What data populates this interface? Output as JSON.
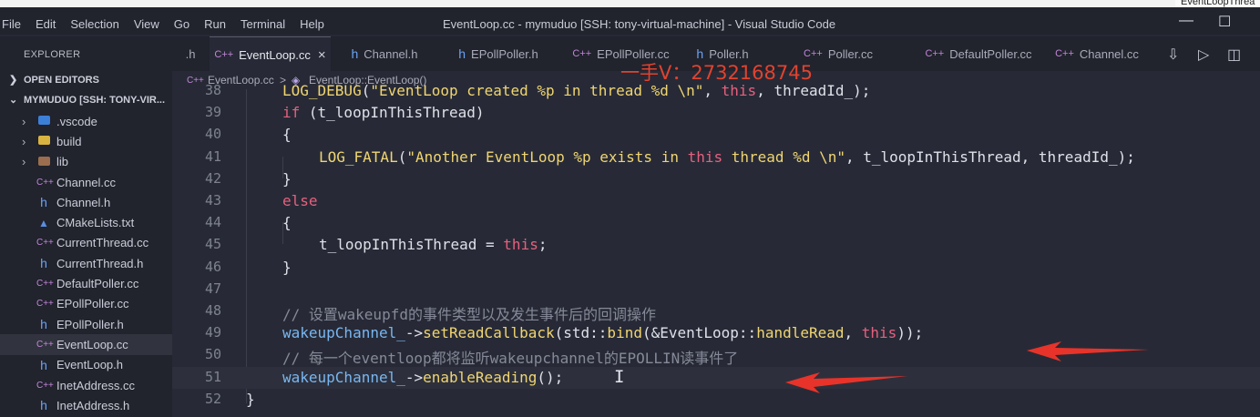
{
  "window": {
    "title": "EventLoop.cc - mymuduo [SSH: tony-virtual-machine] - Visual Studio Code",
    "menu": [
      "File",
      "Edit",
      "Selection",
      "View",
      "Go",
      "Run",
      "Terminal",
      "Help"
    ],
    "minimize": "—",
    "maximize": "☐",
    "top_right_label": "EventLoopThrea"
  },
  "sidebar": {
    "title": "EXPLORER",
    "open_editors": "OPEN EDITORS",
    "workspace": "MYMUDUO [SSH: TONY-VIR...",
    "items": [
      {
        "label": ".vscode",
        "type": "folder",
        "icon": "vscode-folder-icon"
      },
      {
        "label": "build",
        "type": "folder",
        "icon": "folder-icon"
      },
      {
        "label": "lib",
        "type": "folder",
        "icon": "lib-folder-icon"
      },
      {
        "label": "Channel.cc",
        "type": "cc"
      },
      {
        "label": "Channel.h",
        "type": "h"
      },
      {
        "label": "CMakeLists.txt",
        "type": "cmake"
      },
      {
        "label": "CurrentThread.cc",
        "type": "cc"
      },
      {
        "label": "CurrentThread.h",
        "type": "h"
      },
      {
        "label": "DefaultPoller.cc",
        "type": "cc"
      },
      {
        "label": "EPollPoller.cc",
        "type": "cc"
      },
      {
        "label": "EPollPoller.h",
        "type": "h"
      },
      {
        "label": "EventLoop.cc",
        "type": "cc",
        "active": true
      },
      {
        "label": "EventLoop.h",
        "type": "h"
      },
      {
        "label": "InetAddress.cc",
        "type": "cc"
      },
      {
        "label": "InetAddress.h",
        "type": "h"
      }
    ]
  },
  "tabs": [
    {
      "label": ".h",
      "type": "none"
    },
    {
      "label": "EventLoop.cc",
      "type": "cc",
      "active": true
    },
    {
      "label": "Channel.h",
      "type": "h"
    },
    {
      "label": "EPollPoller.h",
      "type": "h"
    },
    {
      "label": "EPollPoller.cc",
      "type": "cc"
    },
    {
      "label": "Poller.h",
      "type": "h"
    },
    {
      "label": "Poller.cc",
      "type": "cc"
    },
    {
      "label": "DefaultPoller.cc",
      "type": "cc"
    },
    {
      "label": "Channel.cc",
      "type": "cc"
    }
  ],
  "tab_close": "×",
  "icons": {
    "cc": "C++",
    "h": "h",
    "cmake": "▲"
  },
  "breadcrumb": {
    "file": "EventLoop.cc",
    "separator": ">",
    "symbol": "EventLoop::EventLoop()"
  },
  "watermark": "一手V：2732168745",
  "editor": {
    "lines": [
      {
        "num": "38",
        "code": "LOG_DEBUG(\"EventLoop created %p in thread %d \\n\", this, threadId_);"
      },
      {
        "num": "39",
        "code": "if (t_loopInThisThread)"
      },
      {
        "num": "40",
        "code": "{"
      },
      {
        "num": "41",
        "code": "LOG_FATAL(\"Another EventLoop %p exists in this thread %d \\n\", t_loopInThisThread, threadId_);"
      },
      {
        "num": "42",
        "code": "}"
      },
      {
        "num": "43",
        "code": "else"
      },
      {
        "num": "44",
        "code": "{"
      },
      {
        "num": "45",
        "code": "t_loopInThisThread = this;"
      },
      {
        "num": "46",
        "code": "}"
      },
      {
        "num": "47",
        "code": ""
      },
      {
        "num": "48",
        "code": "// 设置wakeupfd的事件类型以及发生事件后的回调操作"
      },
      {
        "num": "49",
        "code": "wakeupChannel_->setReadCallback(std::bind(&EventLoop::handleRead, this));"
      },
      {
        "num": "50",
        "code": "// 每一个eventloop都将监听wakeupchannel的EPOLLIN读事件了"
      },
      {
        "num": "51",
        "code": "wakeupChannel_->enableReading();"
      },
      {
        "num": "52",
        "code": "}"
      }
    ]
  },
  "colors": {
    "accent_arrow": "#e8332a",
    "background": "#272a36",
    "sidebar": "#21232d"
  }
}
